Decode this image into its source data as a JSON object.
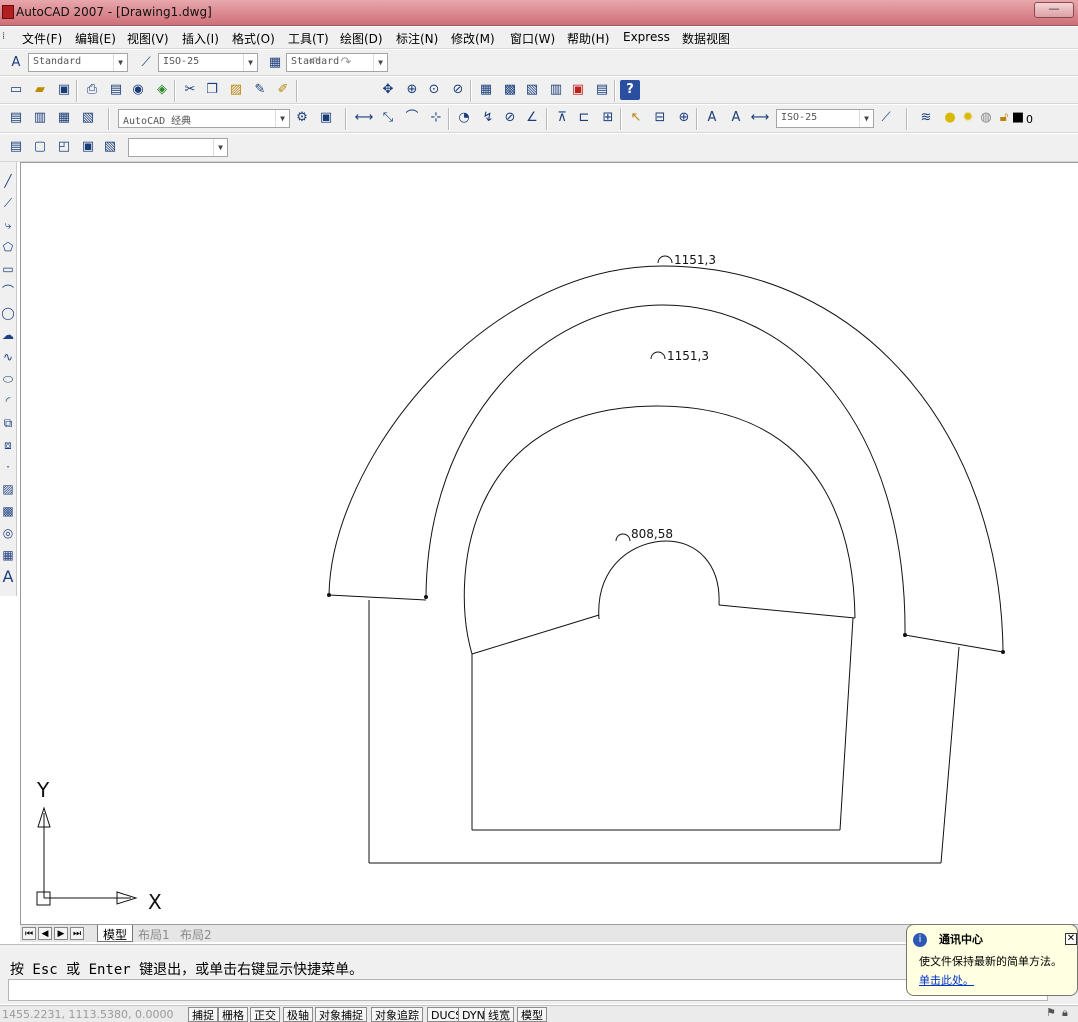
{
  "window": {
    "title": "AutoCAD 2007 - [Drawing1.dwg]"
  },
  "menu": [
    "文件(F)",
    "编辑(E)",
    "视图(V)",
    "插入(I)",
    "格式(O)",
    "工具(T)",
    "绘图(D)",
    "标注(N)",
    "修改(M)",
    "窗口(W)",
    "帮助(H)",
    "Express",
    "数据视图"
  ],
  "styles_toolbar": {
    "text_style": "Standard",
    "dim_style": "ISO-25",
    "table_style": "Standard"
  },
  "workspace": {
    "value": "AutoCAD 经典"
  },
  "dim_toolbar": {
    "dim_style": "ISO-25"
  },
  "layers": {
    "current": "0"
  },
  "drawing": {
    "dimensions": [
      {
        "text": "1151,3"
      },
      {
        "text": "1151,3"
      },
      {
        "text": "808,58"
      }
    ],
    "ucs": {
      "x_label": "X",
      "y_label": "Y"
    }
  },
  "layout_tabs": {
    "items": [
      {
        "label": "模型",
        "active": true
      },
      {
        "label": "布局1",
        "active": false
      },
      {
        "label": "布局2",
        "active": false
      }
    ]
  },
  "command": {
    "prompt": "按 Esc 或 Enter 键退出，或单击右键显示快捷菜单。"
  },
  "status": {
    "coords": "1455.2231,  1113.5380,  0.0000",
    "toggles": [
      "捕捉",
      "栅格",
      "正交",
      "极轴",
      "对象捕捉",
      "对象追踪",
      "DUCS",
      "DYN",
      "线宽",
      "模型"
    ]
  },
  "balloon": {
    "title": "通讯中心",
    "message": "使文件保持最新的简单方法。",
    "link": "单击此处。"
  },
  "colors": {
    "title_bar": "#cf6f78",
    "ui_background": "#f0f0f0",
    "canvas": "#ffffff",
    "link": "#0033cc"
  }
}
